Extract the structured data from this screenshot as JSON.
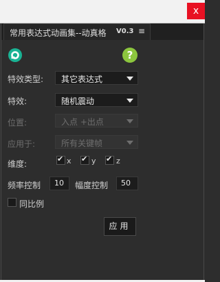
{
  "window": {
    "close_label": "x"
  },
  "panel": {
    "title": "常用表达式动画集--动真格",
    "version": "V0.3",
    "menu_glyph": "≡"
  },
  "help": {
    "glyph": "?"
  },
  "form": {
    "effect_type": {
      "label": "特效类型:",
      "value": "其它表达式"
    },
    "effect": {
      "label": "特效:",
      "value": "随机震动"
    },
    "position": {
      "label": "位置:",
      "value": "入点 +出点"
    },
    "apply_to": {
      "label": "应用于:",
      "value": "所有关键帧"
    },
    "dimensions": {
      "label": "维度:",
      "x": {
        "label": "x",
        "checked": true
      },
      "y": {
        "label": "y",
        "checked": true
      },
      "z": {
        "label": "z",
        "checked": true
      }
    },
    "frequency": {
      "label": "频率控制",
      "value": "10"
    },
    "amplitude": {
      "label": "幅度控制",
      "value": "50"
    },
    "proportional": {
      "label": "同比例",
      "checked": false
    },
    "apply_button": "应用"
  },
  "colors": {
    "accent_green": "#8cc63e",
    "logo_teal": "#1ab394",
    "close_red": "#e81123"
  },
  "check_glyph": "✔"
}
